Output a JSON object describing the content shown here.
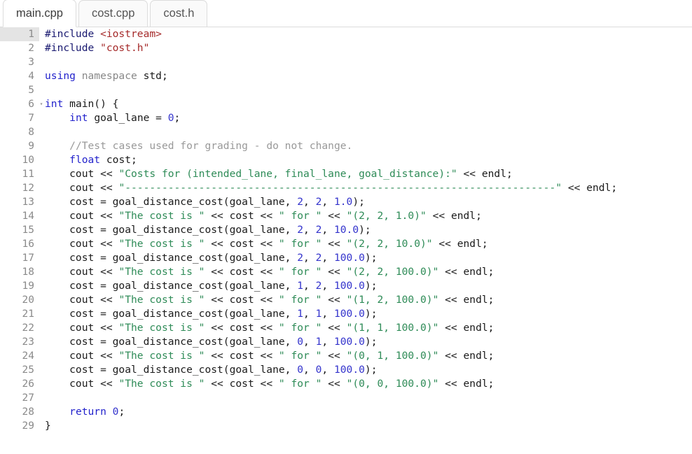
{
  "tabs": [
    {
      "label": "main.cpp",
      "active": true
    },
    {
      "label": "cost.cpp",
      "active": false
    },
    {
      "label": "cost.h",
      "active": false
    }
  ],
  "editor": {
    "active_line": 1,
    "fold_lines": [
      6
    ],
    "total_lines": 29,
    "language": "C++",
    "colors": {
      "preprocessor": "#191970",
      "include_path": "#a52a2a",
      "keyword": "#2222cc",
      "namespace": "#888888",
      "string": "#2e8b57",
      "number": "#3333cc",
      "comment": "#999999",
      "plain": "#1a1a1a",
      "gutter_text": "#8a8a8a",
      "active_gutter_bg": "#e4e4e4",
      "background": "#ffffff"
    },
    "line_numbers": [
      1,
      2,
      3,
      4,
      5,
      6,
      7,
      8,
      9,
      10,
      11,
      12,
      13,
      14,
      15,
      16,
      17,
      18,
      19,
      20,
      21,
      22,
      23,
      24,
      25,
      26,
      27,
      28,
      29
    ],
    "lines": [
      {
        "n": 1,
        "tokens": [
          {
            "t": "#include ",
            "c": "pre"
          },
          {
            "t": "<iostream>",
            "c": "inc"
          }
        ]
      },
      {
        "n": 2,
        "tokens": [
          {
            "t": "#include ",
            "c": "pre"
          },
          {
            "t": "\"cost.h\"",
            "c": "inc"
          }
        ]
      },
      {
        "n": 3,
        "tokens": []
      },
      {
        "n": 4,
        "tokens": [
          {
            "t": "using ",
            "c": "kw"
          },
          {
            "t": "namespace ",
            "c": "ns"
          },
          {
            "t": "std;",
            "c": "plain"
          }
        ]
      },
      {
        "n": 5,
        "tokens": []
      },
      {
        "n": 6,
        "tokens": [
          {
            "t": "int ",
            "c": "kw"
          },
          {
            "t": "main() {",
            "c": "plain"
          }
        ]
      },
      {
        "n": 7,
        "tokens": [
          {
            "t": "    ",
            "c": "plain"
          },
          {
            "t": "int ",
            "c": "kw"
          },
          {
            "t": "goal_lane = ",
            "c": "plain"
          },
          {
            "t": "0",
            "c": "num"
          },
          {
            "t": ";",
            "c": "plain"
          }
        ]
      },
      {
        "n": 8,
        "tokens": []
      },
      {
        "n": 9,
        "tokens": [
          {
            "t": "    ",
            "c": "plain"
          },
          {
            "t": "//Test cases used for grading - do not change.",
            "c": "com"
          }
        ]
      },
      {
        "n": 10,
        "tokens": [
          {
            "t": "    ",
            "c": "plain"
          },
          {
            "t": "float ",
            "c": "kw"
          },
          {
            "t": "cost;",
            "c": "plain"
          }
        ]
      },
      {
        "n": 11,
        "tokens": [
          {
            "t": "    cout << ",
            "c": "plain"
          },
          {
            "t": "\"Costs for (intended_lane, final_lane, goal_distance):\"",
            "c": "str"
          },
          {
            "t": " << endl;",
            "c": "plain"
          }
        ]
      },
      {
        "n": 12,
        "tokens": [
          {
            "t": "    cout << ",
            "c": "plain"
          },
          {
            "t": "\"----------------------------------------------------------------------\"",
            "c": "str"
          },
          {
            "t": " << endl;",
            "c": "plain"
          }
        ]
      },
      {
        "n": 13,
        "tokens": [
          {
            "t": "    cost = goal_distance_cost(goal_lane, ",
            "c": "plain"
          },
          {
            "t": "2",
            "c": "num"
          },
          {
            "t": ", ",
            "c": "plain"
          },
          {
            "t": "2",
            "c": "num"
          },
          {
            "t": ", ",
            "c": "plain"
          },
          {
            "t": "1.0",
            "c": "num"
          },
          {
            "t": ");",
            "c": "plain"
          }
        ]
      },
      {
        "n": 14,
        "tokens": [
          {
            "t": "    cout << ",
            "c": "plain"
          },
          {
            "t": "\"The cost is \"",
            "c": "str"
          },
          {
            "t": " << cost << ",
            "c": "plain"
          },
          {
            "t": "\" for \"",
            "c": "str"
          },
          {
            "t": " << ",
            "c": "plain"
          },
          {
            "t": "\"(2, 2, 1.0)\"",
            "c": "str"
          },
          {
            "t": " << endl;",
            "c": "plain"
          }
        ]
      },
      {
        "n": 15,
        "tokens": [
          {
            "t": "    cost = goal_distance_cost(goal_lane, ",
            "c": "plain"
          },
          {
            "t": "2",
            "c": "num"
          },
          {
            "t": ", ",
            "c": "plain"
          },
          {
            "t": "2",
            "c": "num"
          },
          {
            "t": ", ",
            "c": "plain"
          },
          {
            "t": "10.0",
            "c": "num"
          },
          {
            "t": ");",
            "c": "plain"
          }
        ]
      },
      {
        "n": 16,
        "tokens": [
          {
            "t": "    cout << ",
            "c": "plain"
          },
          {
            "t": "\"The cost is \"",
            "c": "str"
          },
          {
            "t": " << cost << ",
            "c": "plain"
          },
          {
            "t": "\" for \"",
            "c": "str"
          },
          {
            "t": " << ",
            "c": "plain"
          },
          {
            "t": "\"(2, 2, 10.0)\"",
            "c": "str"
          },
          {
            "t": " << endl;",
            "c": "plain"
          }
        ]
      },
      {
        "n": 17,
        "tokens": [
          {
            "t": "    cost = goal_distance_cost(goal_lane, ",
            "c": "plain"
          },
          {
            "t": "2",
            "c": "num"
          },
          {
            "t": ", ",
            "c": "plain"
          },
          {
            "t": "2",
            "c": "num"
          },
          {
            "t": ", ",
            "c": "plain"
          },
          {
            "t": "100.0",
            "c": "num"
          },
          {
            "t": ");",
            "c": "plain"
          }
        ]
      },
      {
        "n": 18,
        "tokens": [
          {
            "t": "    cout << ",
            "c": "plain"
          },
          {
            "t": "\"The cost is \"",
            "c": "str"
          },
          {
            "t": " << cost << ",
            "c": "plain"
          },
          {
            "t": "\" for \"",
            "c": "str"
          },
          {
            "t": " << ",
            "c": "plain"
          },
          {
            "t": "\"(2, 2, 100.0)\"",
            "c": "str"
          },
          {
            "t": " << endl;",
            "c": "plain"
          }
        ]
      },
      {
        "n": 19,
        "tokens": [
          {
            "t": "    cost = goal_distance_cost(goal_lane, ",
            "c": "plain"
          },
          {
            "t": "1",
            "c": "num"
          },
          {
            "t": ", ",
            "c": "plain"
          },
          {
            "t": "2",
            "c": "num"
          },
          {
            "t": ", ",
            "c": "plain"
          },
          {
            "t": "100.0",
            "c": "num"
          },
          {
            "t": ");",
            "c": "plain"
          }
        ]
      },
      {
        "n": 20,
        "tokens": [
          {
            "t": "    cout << ",
            "c": "plain"
          },
          {
            "t": "\"The cost is \"",
            "c": "str"
          },
          {
            "t": " << cost << ",
            "c": "plain"
          },
          {
            "t": "\" for \"",
            "c": "str"
          },
          {
            "t": " << ",
            "c": "plain"
          },
          {
            "t": "\"(1, 2, 100.0)\"",
            "c": "str"
          },
          {
            "t": " << endl;",
            "c": "plain"
          }
        ]
      },
      {
        "n": 21,
        "tokens": [
          {
            "t": "    cost = goal_distance_cost(goal_lane, ",
            "c": "plain"
          },
          {
            "t": "1",
            "c": "num"
          },
          {
            "t": ", ",
            "c": "plain"
          },
          {
            "t": "1",
            "c": "num"
          },
          {
            "t": ", ",
            "c": "plain"
          },
          {
            "t": "100.0",
            "c": "num"
          },
          {
            "t": ");",
            "c": "plain"
          }
        ]
      },
      {
        "n": 22,
        "tokens": [
          {
            "t": "    cout << ",
            "c": "plain"
          },
          {
            "t": "\"The cost is \"",
            "c": "str"
          },
          {
            "t": " << cost << ",
            "c": "plain"
          },
          {
            "t": "\" for \"",
            "c": "str"
          },
          {
            "t": " << ",
            "c": "plain"
          },
          {
            "t": "\"(1, 1, 100.0)\"",
            "c": "str"
          },
          {
            "t": " << endl;",
            "c": "plain"
          }
        ]
      },
      {
        "n": 23,
        "tokens": [
          {
            "t": "    cost = goal_distance_cost(goal_lane, ",
            "c": "plain"
          },
          {
            "t": "0",
            "c": "num"
          },
          {
            "t": ", ",
            "c": "plain"
          },
          {
            "t": "1",
            "c": "num"
          },
          {
            "t": ", ",
            "c": "plain"
          },
          {
            "t": "100.0",
            "c": "num"
          },
          {
            "t": ");",
            "c": "plain"
          }
        ]
      },
      {
        "n": 24,
        "tokens": [
          {
            "t": "    cout << ",
            "c": "plain"
          },
          {
            "t": "\"The cost is \"",
            "c": "str"
          },
          {
            "t": " << cost << ",
            "c": "plain"
          },
          {
            "t": "\" for \"",
            "c": "str"
          },
          {
            "t": " << ",
            "c": "plain"
          },
          {
            "t": "\"(0, 1, 100.0)\"",
            "c": "str"
          },
          {
            "t": " << endl;",
            "c": "plain"
          }
        ]
      },
      {
        "n": 25,
        "tokens": [
          {
            "t": "    cost = goal_distance_cost(goal_lane, ",
            "c": "plain"
          },
          {
            "t": "0",
            "c": "num"
          },
          {
            "t": ", ",
            "c": "plain"
          },
          {
            "t": "0",
            "c": "num"
          },
          {
            "t": ", ",
            "c": "plain"
          },
          {
            "t": "100.0",
            "c": "num"
          },
          {
            "t": ");",
            "c": "plain"
          }
        ]
      },
      {
        "n": 26,
        "tokens": [
          {
            "t": "    cout << ",
            "c": "plain"
          },
          {
            "t": "\"The cost is \"",
            "c": "str"
          },
          {
            "t": " << cost << ",
            "c": "plain"
          },
          {
            "t": "\" for \"",
            "c": "str"
          },
          {
            "t": " << ",
            "c": "plain"
          },
          {
            "t": "\"(0, 0, 100.0)\"",
            "c": "str"
          },
          {
            "t": " << endl;",
            "c": "plain"
          }
        ]
      },
      {
        "n": 27,
        "tokens": []
      },
      {
        "n": 28,
        "tokens": [
          {
            "t": "    ",
            "c": "plain"
          },
          {
            "t": "return ",
            "c": "kw"
          },
          {
            "t": "0",
            "c": "num"
          },
          {
            "t": ";",
            "c": "plain"
          }
        ]
      },
      {
        "n": 29,
        "tokens": [
          {
            "t": "}",
            "c": "plain"
          }
        ]
      }
    ]
  },
  "icons": {
    "fold_collapse": "▾"
  }
}
